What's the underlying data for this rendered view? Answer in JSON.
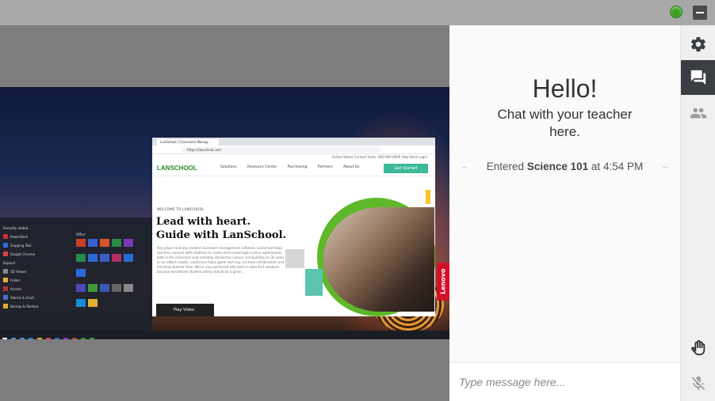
{
  "window": {
    "status_color": "#3aa020",
    "controls": {
      "minimize_icon": "minimize-icon",
      "status_icon": "status-dot-icon"
    }
  },
  "remote_screen": {
    "browser": {
      "tab_title": "LanSchool | Classroom Manag...",
      "url": "https://lanschool.com",
      "top_links": "United States    Contact Sales: 800-000-0000    Help Desk    Login",
      "logo": "LANSCHOOL",
      "nav": [
        "Solutions",
        "Resource Center",
        "Purchasing",
        "Partners",
        "About Us"
      ],
      "cta": "Get Started",
      "eyebrow": "WELCOME TO LANSCHOOL",
      "hero_line1": "Lead with heart.",
      "hero_line2": "Guide with LanSchool.",
      "hero_body": "Any player and any student classroom management software. LanSchool helps teachers connect with students to create more meaningful online experiences, both in the classroom and remotely. Backed by Lenovo and building on 30 years as an edtech leader, LanSchool helps guide learning, increase collaboration and minimize teacher time. We've also partnered with best-in-class K12 solutions because we believe student safety should be a given.",
      "play_label": "Play Video"
    },
    "start_menu": {
      "section_recent": "Recently added",
      "section_office": "Office",
      "items": [
        "PowerShell",
        "Snipping Tool",
        "Google Chrome",
        "Expand",
        "3D Viewer",
        "Folder",
        "Access",
        "Alarms & Clock",
        "Backup & Restore"
      ]
    },
    "brand_tag": "Lenovo"
  },
  "chat": {
    "greeting": "Hello!",
    "subtitle": "Chat with your teacher here.",
    "entered_prefix": "Entered",
    "class_name": "Science 101",
    "entered_mid": "at",
    "entered_time": "4:54 PM",
    "input_placeholder": "Type message here..."
  },
  "rail": {
    "settings_icon": "gear-icon",
    "chat_icon": "chat-icon",
    "people_icon": "people-icon",
    "hand_icon": "raise-hand-icon",
    "mic_icon": "mic-muted-icon",
    "active_bg": "#3b3f44"
  }
}
